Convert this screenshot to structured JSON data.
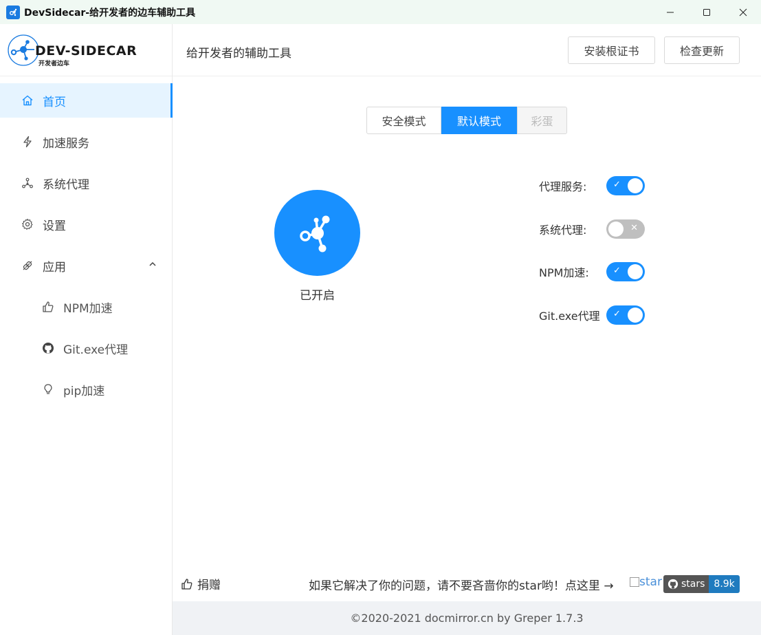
{
  "window": {
    "title": "DevSidecar-给开发者的边车辅助工具"
  },
  "logo": {
    "text": "DEV-SIDECAR",
    "sub": "开发者边车"
  },
  "sidebar": {
    "items": [
      {
        "label": "首页",
        "icon": "home-icon"
      },
      {
        "label": "加速服务",
        "icon": "lightning-icon"
      },
      {
        "label": "系统代理",
        "icon": "network-icon"
      },
      {
        "label": "设置",
        "icon": "gear-icon"
      },
      {
        "label": "应用",
        "icon": "plugin-icon"
      }
    ],
    "subitems": [
      {
        "label": "NPM加速",
        "icon": "thumbs-up-icon"
      },
      {
        "label": "Git.exe代理",
        "icon": "github-icon"
      },
      {
        "label": "pip加速",
        "icon": "bulb-icon"
      }
    ]
  },
  "header": {
    "title": "给开发者的辅助工具",
    "install_cert": "安装根证书",
    "check_update": "检查更新"
  },
  "modes": {
    "safe": "安全模式",
    "default": "默认模式",
    "egg": "彩蛋"
  },
  "status": {
    "text": "已开启"
  },
  "toggles": [
    {
      "label": "代理服务:",
      "on": true
    },
    {
      "label": "系统代理:",
      "on": false
    },
    {
      "label": "NPM加速:",
      "on": true
    },
    {
      "label": "Git.exe代理",
      "on": true
    }
  ],
  "footer": {
    "donate": "捐赠",
    "star_note": "如果它解决了你的问题，请不要吝啬你的star哟！点这里 →",
    "star_img_alt": "star",
    "badge_label": "stars",
    "badge_count": "8.9k",
    "copyright": "©2020-2021 docmirror.cn by Greper 1.7.3"
  },
  "colors": {
    "accent": "#1890ff",
    "switch_off": "#bfbfbf"
  }
}
